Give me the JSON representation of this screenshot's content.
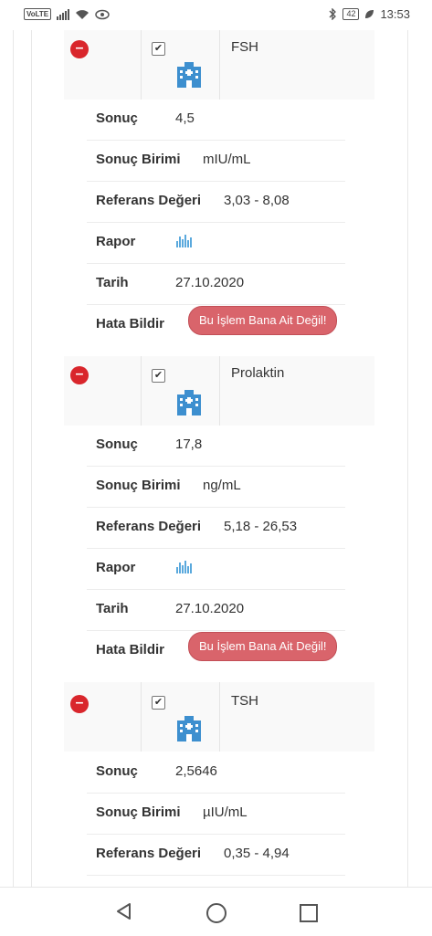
{
  "status": {
    "left_badge": "VoLTE",
    "battery": "42",
    "time": "13:53"
  },
  "labels": {
    "result": "Sonuç",
    "unit": "Sonuç Birimi",
    "reference": "Referans Değeri",
    "report": "Rapor",
    "date": "Tarih",
    "report_error": "Hata Bildir",
    "error_button": "Bu İşlem Bana Ait Değil!"
  },
  "tests": [
    {
      "name": "FSH",
      "checked": true,
      "result": "4,5",
      "unit": "mIU/mL",
      "reference": "3,03 - 8,08",
      "date": "27.10.2020",
      "report_icon": "bar-chart-icon"
    },
    {
      "name": "Prolaktin",
      "checked": true,
      "result": "17,8",
      "unit": "ng/mL",
      "reference": "5,18 - 26,53",
      "date": "27.10.2020",
      "report_icon": "bar-chart-icon"
    },
    {
      "name": "TSH",
      "checked": true,
      "result": "2,5646",
      "unit": "µIU/mL",
      "reference": "0,35 - 4,94"
    }
  ],
  "colors": {
    "remove": "#d9262c",
    "error_button": "#d9646b",
    "hospital_icon": "#3d8fcf"
  },
  "nav": {
    "back_icon": "back-triangle-icon",
    "home_icon": "home-circle-icon",
    "recent_icon": "recent-square-icon"
  }
}
